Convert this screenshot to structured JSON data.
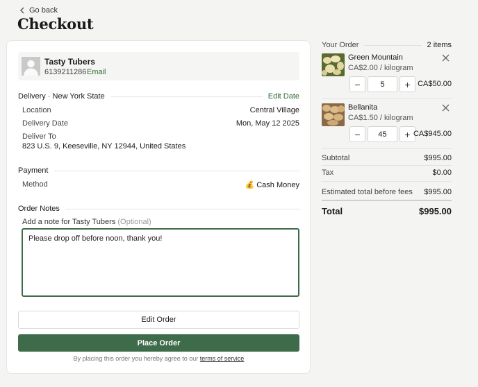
{
  "nav": {
    "back_label": "Go back"
  },
  "page": {
    "title": "Checkout"
  },
  "seller": {
    "name": "Tasty Tubers",
    "phone": "6139211286",
    "email_label": "Email"
  },
  "delivery": {
    "heading": "Delivery · New York State",
    "edit_label": "Edit Date",
    "location_label": "Location",
    "location_value": "Central Village",
    "date_label": "Delivery Date",
    "date_value": "Mon, May 12 2025",
    "deliver_to_label": "Deliver To",
    "address": "823 U.S. 9, Keeseville, NY 12944, United States"
  },
  "payment": {
    "heading": "Payment",
    "method_label": "Method",
    "method_value": "💰 Cash Money"
  },
  "notes": {
    "heading": "Order Notes",
    "label": "Add a note for Tasty Tubers",
    "optional": "(Optional)",
    "value": "Please drop off before noon, thank you!"
  },
  "actions": {
    "edit_order": "Edit Order",
    "place_order": "Place Order",
    "terms_prefix": "By placing this order you hereby agree to our",
    "terms_link": "terms of service"
  },
  "order": {
    "heading": "Your Order",
    "count": "2 items",
    "items": [
      {
        "name": "Green Mountain",
        "price": "CA$2.00 / kilogram",
        "qty": "5",
        "total": "CA$50.00",
        "icon": "potato-thumbnail-icon"
      },
      {
        "name": "Bellanita",
        "price": "CA$1.50 / kilogram",
        "qty": "45",
        "total": "CA$945.00",
        "icon": "potato-thumbnail-icon"
      }
    ],
    "minus": "−",
    "plus": "+",
    "subtotal_label": "Subtotal",
    "subtotal_value": "$995.00",
    "tax_label": "Tax",
    "tax_value": "$0.00",
    "estimate_label": "Estimated total before fees",
    "estimate_value": "$995.00",
    "total_label": "Total",
    "total_value": "$995.00"
  },
  "colors": {
    "accent": "#3e6b4a",
    "link": "#2f6b3a",
    "background": "#f4f4f3"
  }
}
